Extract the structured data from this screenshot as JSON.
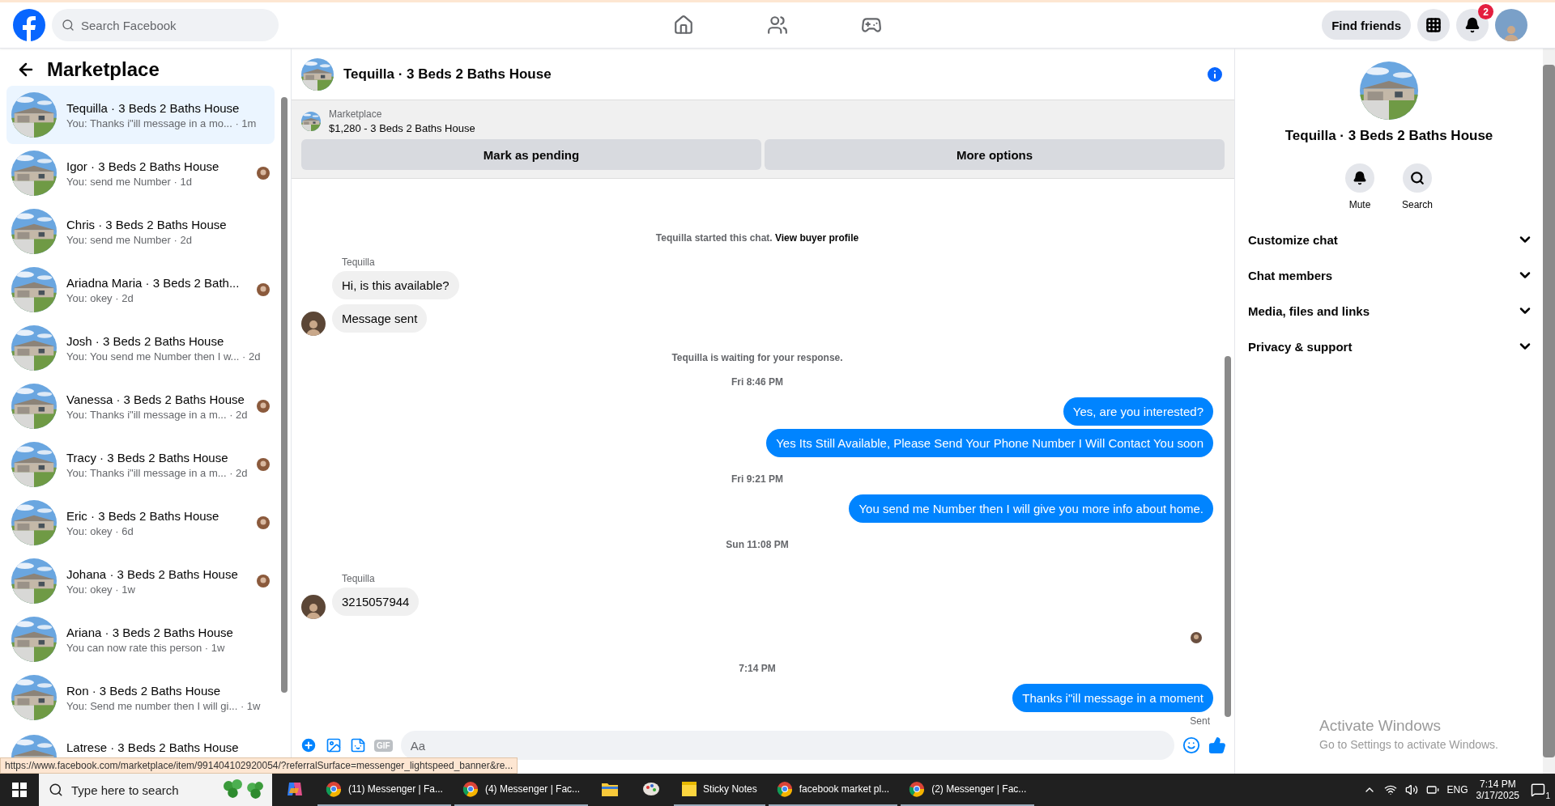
{
  "topbar": {
    "search": {
      "placeholder": "Search Facebook"
    },
    "find_friends": "Find friends",
    "notifications_badge": "2"
  },
  "sidebar": {
    "title": "Marketplace",
    "conversations": [
      {
        "title": "Tequilla · 3 Beds 2 Baths House",
        "snippet": "You: Thanks i\"ill message in a mo...",
        "time": "· 1m",
        "selected": true,
        "read_receipt": false
      },
      {
        "title": "Igor · 3 Beds 2 Baths House",
        "snippet": "You: send me Number",
        "time": "· 1d",
        "selected": false,
        "read_receipt": true
      },
      {
        "title": "Chris · 3 Beds 2 Baths House",
        "snippet": "You: send me Number",
        "time": "· 2d",
        "selected": false,
        "read_receipt": false
      },
      {
        "title": "Ariadna Maria · 3 Beds 2 Bath...",
        "snippet": "You: okey",
        "time": "· 2d",
        "selected": false,
        "read_receipt": true
      },
      {
        "title": "Josh · 3 Beds 2 Baths House",
        "snippet": "You: You send me Number then I w...",
        "time": "· 2d",
        "selected": false,
        "read_receipt": false
      },
      {
        "title": "Vanessa · 3 Beds 2 Baths House",
        "snippet": "You: Thanks i\"ill message in a m...",
        "time": "· 2d",
        "selected": false,
        "read_receipt": true
      },
      {
        "title": "Tracy · 3 Beds 2 Baths House",
        "snippet": "You: Thanks i\"ill message in a m...",
        "time": "· 2d",
        "selected": false,
        "read_receipt": true
      },
      {
        "title": "Eric · 3 Beds 2 Baths House",
        "snippet": "You: okey",
        "time": "· 6d",
        "selected": false,
        "read_receipt": true
      },
      {
        "title": "Johana · 3 Beds 2 Baths House",
        "snippet": "You: okey",
        "time": "· 1w",
        "selected": false,
        "read_receipt": true
      },
      {
        "title": "Ariana · 3 Beds 2 Baths House",
        "snippet": "You can now rate this person",
        "time": "· 1w",
        "selected": false,
        "read_receipt": false
      },
      {
        "title": "Ron · 3 Beds 2 Baths House",
        "snippet": "You: Send me number then I will gi...",
        "time": "· 1w",
        "selected": false,
        "read_receipt": false
      },
      {
        "title": "Latrese · 3 Beds 2 Baths House",
        "selected": false,
        "read_receipt": false
      }
    ]
  },
  "chat": {
    "title": "Tequilla · 3 Beds 2 Baths House",
    "listing": {
      "source": "Marketplace",
      "price_title": "$1,280 - 3 Beds 2 Baths House",
      "actions": [
        "Mark as pending",
        "More options"
      ]
    },
    "messages": [
      {
        "kind": "system",
        "text": "Tequilla started this chat.",
        "link": "View buyer profile"
      },
      {
        "kind": "sender",
        "text": "Tequilla"
      },
      {
        "kind": "incoming",
        "text": "Hi, is this available?",
        "avatar": false
      },
      {
        "kind": "incoming",
        "text": "Message sent",
        "avatar": true
      },
      {
        "kind": "system",
        "text": "Tequilla is waiting for your response."
      },
      {
        "kind": "time",
        "text": "Fri 8:46 PM"
      },
      {
        "kind": "outgoing",
        "text": "Yes, are you interested?"
      },
      {
        "kind": "outgoing",
        "text": "Yes Its Still Available, Please Send Your Phone Number I Will Contact You soon"
      },
      {
        "kind": "time",
        "text": "Fri 9:21 PM"
      },
      {
        "kind": "outgoing",
        "text": "You send me Number then I will give you more info about home."
      },
      {
        "kind": "time",
        "text": "Sun 11:08 PM"
      },
      {
        "kind": "sender",
        "text": "Tequilla"
      },
      {
        "kind": "incoming",
        "text": "3215057944",
        "avatar": true
      },
      {
        "kind": "seen"
      },
      {
        "kind": "time",
        "text": "7:14 PM"
      },
      {
        "kind": "outgoing",
        "text": "Thanks i\"ill message in a moment"
      },
      {
        "kind": "status",
        "text": "Sent"
      }
    ],
    "composer": {
      "gif_label": "GIF",
      "placeholder": "Aa"
    }
  },
  "details": {
    "title": "Tequilla · 3 Beds 2 Baths House",
    "actions": [
      "Mute",
      "Search"
    ],
    "sections": [
      {
        "label": "Customize chat",
        "expanded": false
      },
      {
        "label": "Chat members",
        "expanded": false
      },
      {
        "label": "Media, files and links",
        "expanded": false
      },
      {
        "label": "Privacy & support",
        "expanded": false
      }
    ]
  },
  "link_preview": "https://www.facebook.com/marketplace/item/991404102920054/?referralSurface=messenger_lightspeed_banner&re...",
  "activation_notice": {
    "title": "Activate Windows",
    "text": "Go to Settings to activate Windows."
  },
  "taskbar": {
    "search": {
      "placeholder": "Type here to search"
    },
    "apps": [
      {
        "kind": "copilot"
      },
      {
        "kind": "browser",
        "label": "(11) Messenger | Fa..."
      },
      {
        "kind": "browser",
        "label": "(4) Messenger | Fac..."
      },
      {
        "kind": "folder"
      },
      {
        "kind": "paint"
      },
      {
        "kind": "notes",
        "label": "Sticky Notes"
      },
      {
        "kind": "browser",
        "label": "facebook market pl..."
      },
      {
        "kind": "browser",
        "label": "(2) Messenger | Fac..."
      }
    ],
    "language": "ENG",
    "time": "7:14 PM",
    "date": "3/17/2025",
    "notification_count": "1"
  }
}
